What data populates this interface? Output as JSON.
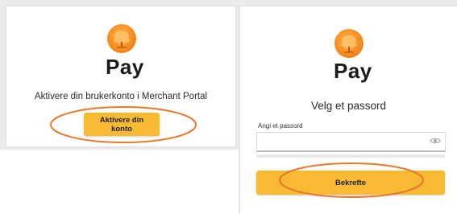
{
  "brand": {
    "name": "Pay",
    "logo_color": "#f58a1e",
    "text_color": "#1a1a1a"
  },
  "left_panel": {
    "heading": "Aktivere din brukerkonto i Merchant Portal",
    "activate_button": "Aktivere din konto"
  },
  "right_panel": {
    "heading": "Velg et passord",
    "password_label": "Angi et passord",
    "password_value": "",
    "confirm_button": "Bekrefte",
    "reveal_icon": "eye-icon"
  },
  "colors": {
    "button": "#f8ba33",
    "highlight_ellipse": "#e8772e",
    "background": "#ebebeb"
  }
}
